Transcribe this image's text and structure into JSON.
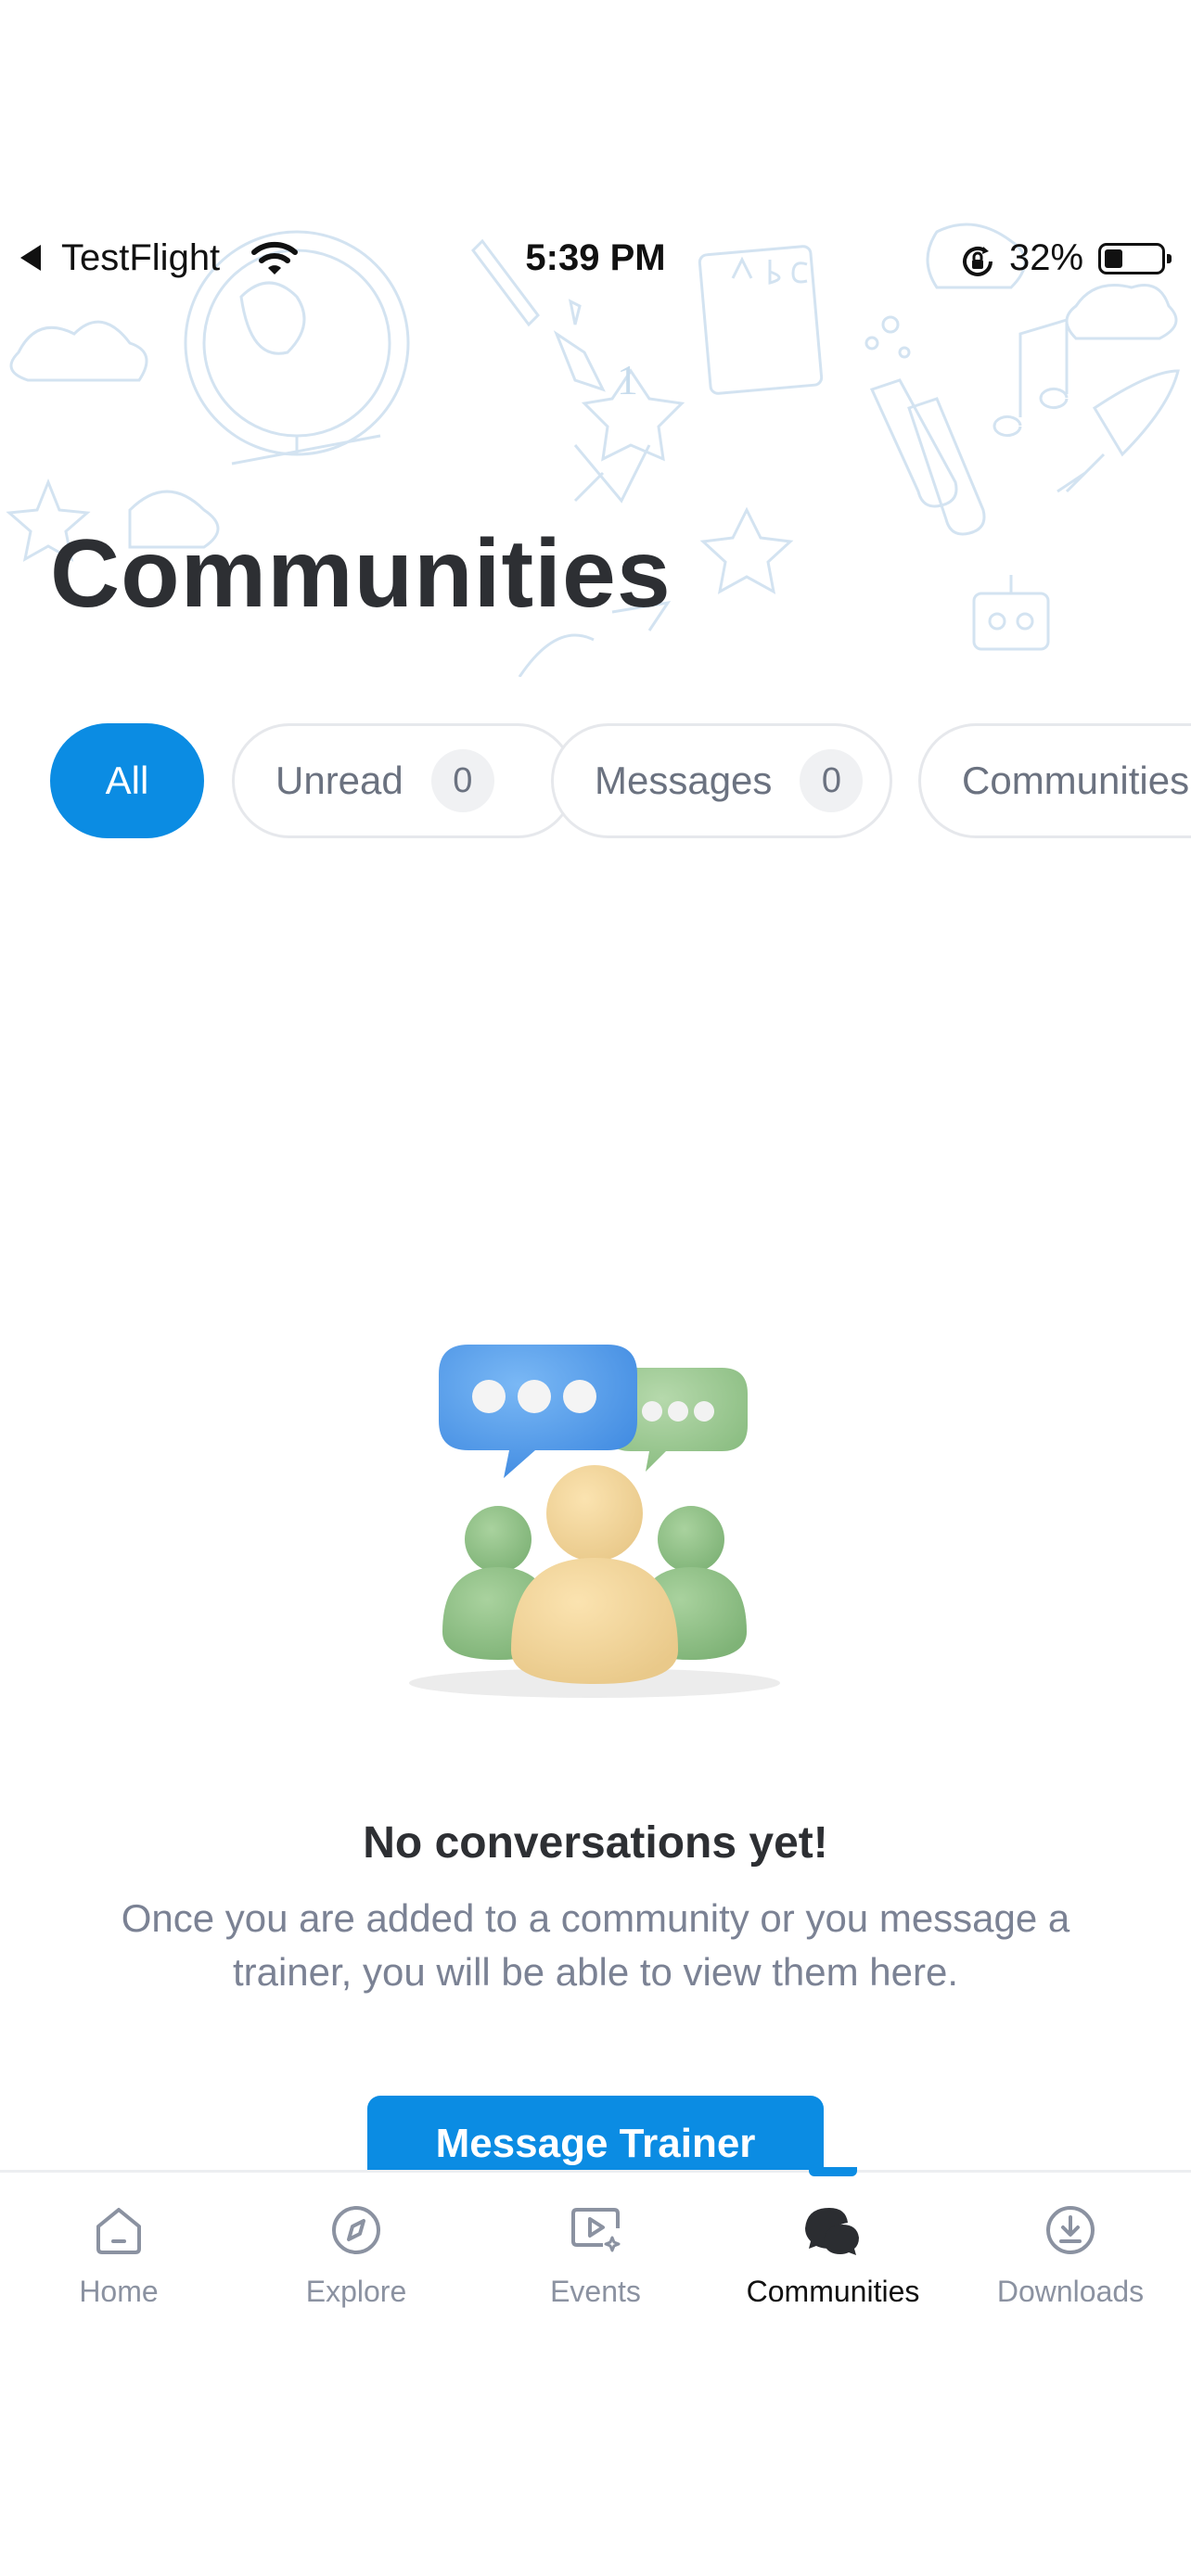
{
  "status_bar": {
    "carrier": "TestFlight",
    "time": "5:39 PM",
    "battery_percent": "32%",
    "battery_level": 0.32,
    "icons": [
      "back-arrow-icon",
      "wifi-icon",
      "orientation-lock-icon",
      "battery-icon"
    ]
  },
  "header": {
    "title": "Communities"
  },
  "filters": {
    "items": [
      {
        "label": "All",
        "active": true
      },
      {
        "label": "Unread",
        "count": "0"
      },
      {
        "label": "Messages",
        "count": "0"
      },
      {
        "label": "Communities"
      }
    ]
  },
  "empty_state": {
    "title": "No conversations yet!",
    "description_line1": "Once you are added to a community or you message a",
    "description_line2": "trainer, you will be able to view them here.",
    "button_label": "Message Trainer",
    "illustration": "community-chat-illustration"
  },
  "tab_bar": {
    "active": "communities",
    "tabs": [
      {
        "id": "home",
        "label": "Home",
        "icon": "home-icon"
      },
      {
        "id": "explore",
        "label": "Explore",
        "icon": "compass-icon"
      },
      {
        "id": "events",
        "label": "Events",
        "icon": "video-play-icon"
      },
      {
        "id": "communities",
        "label": "Communities",
        "icon": "chat-bubbles-icon"
      },
      {
        "id": "downloads",
        "label": "Downloads",
        "icon": "download-icon"
      }
    ]
  },
  "colors": {
    "accent": "#0b8ce3",
    "text_primary": "#2d2f33",
    "text_secondary": "#7b8294",
    "doodle": "#d6e6f3"
  }
}
